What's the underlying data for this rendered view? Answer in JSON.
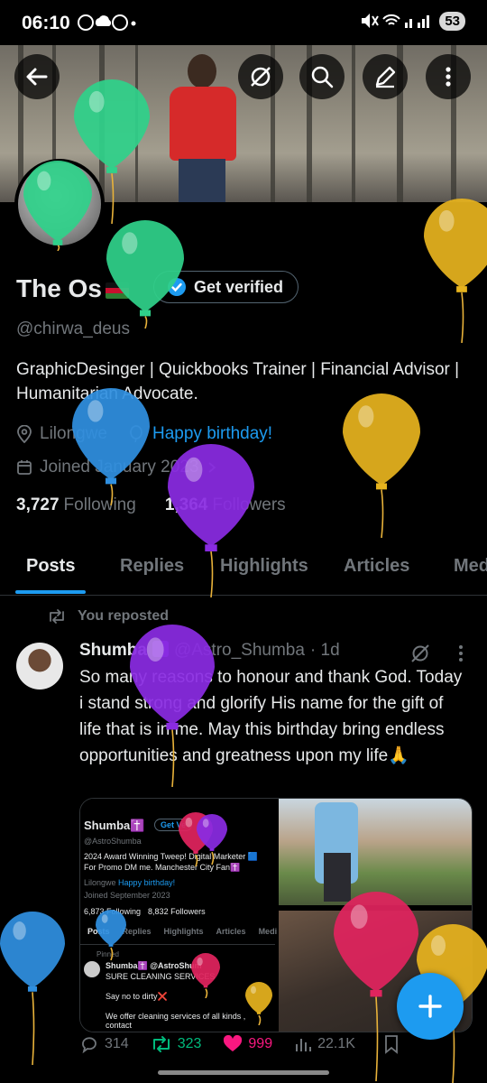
{
  "status": {
    "time": "06:10",
    "battery": "53"
  },
  "profile": {
    "name": "The Os",
    "get_verified": "Get verified",
    "handle": "@chirwa_deus",
    "bio": "GraphicDesinger  |  Quickbooks Trainer | Financial Advisor | Humanitarian Advocate.",
    "location": "Lilongwe",
    "birthday": "Happy birthday!",
    "joined": "Joined January 2023",
    "following_count": "3,727",
    "following_label": "Following",
    "followers_count": "1,364",
    "followers_label": "Followers"
  },
  "tabs": [
    "Posts",
    "Replies",
    "Highlights",
    "Articles",
    "Med"
  ],
  "post": {
    "repost_label": "You reposted",
    "author": "Shumba",
    "handle": "@Astro_Shumba",
    "time": "· 1d",
    "text": "So many reasons to honour and thank God. Today i stand strong and glorify His name for the gift of life that is in me. May this birthday bring endless opportunities and greatness upon my life🙏",
    "replies": "314",
    "reposts": "323",
    "likes": "999",
    "views": "22.1K"
  },
  "embedded": {
    "name": "Shumba✝️",
    "get_verified": "Get Ve",
    "handle": "@AstroShumba",
    "bio": "2024 Award Winning Tweep! Digital Marketer 🟦 For Promo DM me. Manchester City Fan✝️",
    "location": "Lilongwe",
    "birthday": "Happy birthday!",
    "joined": "Joined September 2023",
    "following": "6,873 Following",
    "followers": "8,832 Followers",
    "tabs": [
      "Posts",
      "Replies",
      "Highlights",
      "Articles",
      "Medi"
    ],
    "pinned": "Pinned",
    "pinned_author": "Shumba✝️ @AstroShum",
    "pinned_line1": "SURE CLEANING SERVICES",
    "pinned_line2": "Say no to dirty❌",
    "pinned_line3": "We offer cleaning services of all kinds , contact"
  },
  "colors": {
    "accent": "#1d9bf0",
    "like": "#f91880",
    "repost": "#00ba7c",
    "balloon_green": "#2fd18a",
    "balloon_yellow": "#e6b31e",
    "balloon_blue": "#2f8fe0",
    "balloon_purple": "#8a2be2",
    "balloon_pink": "#e0245e"
  }
}
